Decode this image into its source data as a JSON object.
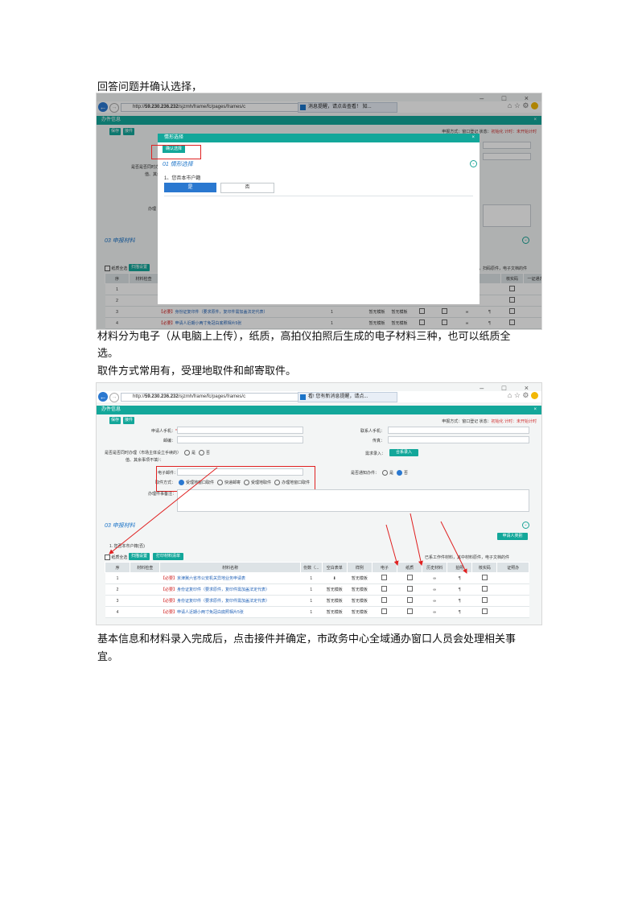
{
  "paragraphs": {
    "p1": "回答问题并确认选择，",
    "p2_line1": "材料分为电子（从电脑上上传），纸质，高拍仪拍照后生成的电子材料三种，也可以纸质全",
    "p2_line2": "选。",
    "p3": "取件方式常用有，受理地取件和邮寄取件。",
    "p4_line1": "基本信息和材料录入完成后，点击接件并确定，市政务中心全域通办窗口人员会处理相关事",
    "p4_line2": "宜。"
  },
  "shot1": {
    "window_controls": "– □ ×",
    "url_prefix": "http://",
    "url_host": "59.230.236.232",
    "url_rest": "/sjzmh/frame/fc/pages/frames/c",
    "tab_title": "消息提醒，请点击查看！ 知...",
    "app_title": "办件信息",
    "save_label": "保存",
    "receive_label": "接件",
    "options_text": "申报方式：窗口登记 状态：",
    "options_status": "初始化 计时：",
    "options_timer": "未开始计时",
    "bg_label_a": "是否是否同时办理（市场主体",
    "bg_label_b": "值、其余事",
    "bg_label_c": "办理",
    "section_materials": "03 申报材料",
    "check_all_label": "纸质全选",
    "scan_button": "扫描设置",
    "right_note": "请扫码后连接的窗口扫码，扫码原件，电子文档的件",
    "table_headers": [
      "序",
      "材料检查",
      "",
      "",
      "",
      "",
      "",
      "",
      "",
      "",
      "",
      "",
      "核实码",
      "一证通办"
    ],
    "rows": [
      {
        "no": "1",
        "req": "【",
        "name": "",
        "qty": "",
        "a": "",
        "b": ""
      },
      {
        "no": "2",
        "req": "【",
        "name": "",
        "qty": "",
        "a": "",
        "b": ""
      },
      {
        "no": "3",
        "req": "【必要】",
        "name": "身份证复印件（要求原件，复印件需加盖法定代表）",
        "qty": "1",
        "a": "暂无模板",
        "b": "暂无模板"
      },
      {
        "no": "4",
        "req": "【必要】",
        "name": "申请人近期小两寸免冠白底照相片5张",
        "qty": "1",
        "a": "暂无模板",
        "b": "暂无模板"
      }
    ],
    "modal": {
      "title": "情形选择",
      "confirm_button": "确认选择",
      "section_title": "01 情形选择",
      "question": "1、您否本市户籍",
      "option_yes": "是",
      "option_no": "否"
    }
  },
  "shot2": {
    "window_controls": "– □ ×",
    "url_prefix": "http://",
    "url_host": "59.230.236.232",
    "url_rest": "/sjzmh/frame/fc/pages/frames/c",
    "tab_title": "看! 您有新消息提醒，请点...",
    "app_title": "办件信息",
    "save_label": "保存",
    "receive_label": "接件",
    "options_text": "申报方式：窗口登记 状态：",
    "options_status": "初始化 计时：",
    "options_timer": "未开始计时",
    "applicant_phone_label": "申请人手机：",
    "contact_phone_label": "联系人手机：",
    "postcode_label": "邮编：",
    "fax_label": "传真：",
    "same_time_label": "是否是否同时办理（市场主体设立手续的）",
    "same_time_label2": "值、其余事项不填）：",
    "yes": "是",
    "no": "否",
    "import_label": "需求录入：",
    "import_button": "合系录入",
    "email_label": "电子邮件：",
    "fast_label": "是否通知办件：",
    "pickup_label": "取件方式：",
    "pickup_options": [
      "受理地窗口取件",
      "快递邮寄",
      "受理地取件",
      "办理地窗口取件"
    ],
    "remark_label": "办理件事备注：",
    "section_materials": "03 申报材料",
    "report_button": "申请人类别",
    "case_label": "1. 您否本市户籍(否)",
    "check_all_label": "纸质全选",
    "scan_button": "扫描设置",
    "print_button": "打印材料清单",
    "right_note": "已系工作件材料，其中材料原件，电子文档的件",
    "table_headers": [
      "序",
      "材料检查",
      "材料名称",
      "份数（...",
      "空白表单",
      "样例",
      "电子",
      "纸质",
      "历史材料",
      "拍照",
      "核实码",
      "证照办"
    ],
    "rows": [
      {
        "no": "1",
        "req": "【必要】",
        "name": "京津冀六省市公安机关异地业务申请表",
        "qty": "1",
        "a": "",
        "b": "暂无模板"
      },
      {
        "no": "2",
        "req": "【必要】",
        "name": "身份证复印件（要求原件，复印件需加盖法定代表）",
        "qty": "1",
        "a": "暂无模板",
        "b": "暂无模板"
      },
      {
        "no": "3",
        "req": "【必要】",
        "name": "身份证复印件（要求原件，复印件需加盖法定代表）",
        "qty": "1",
        "a": "暂无模板",
        "b": "暂无模板"
      },
      {
        "no": "4",
        "req": "【必要】",
        "name": "申请人近期小两寸免冠白底照相片5张",
        "qty": "1",
        "a": "暂无模板",
        "b": "暂无模板"
      }
    ]
  },
  "colors": {
    "teal": "#13a79a",
    "blue": "#2a78d0",
    "red": "#e02020"
  }
}
